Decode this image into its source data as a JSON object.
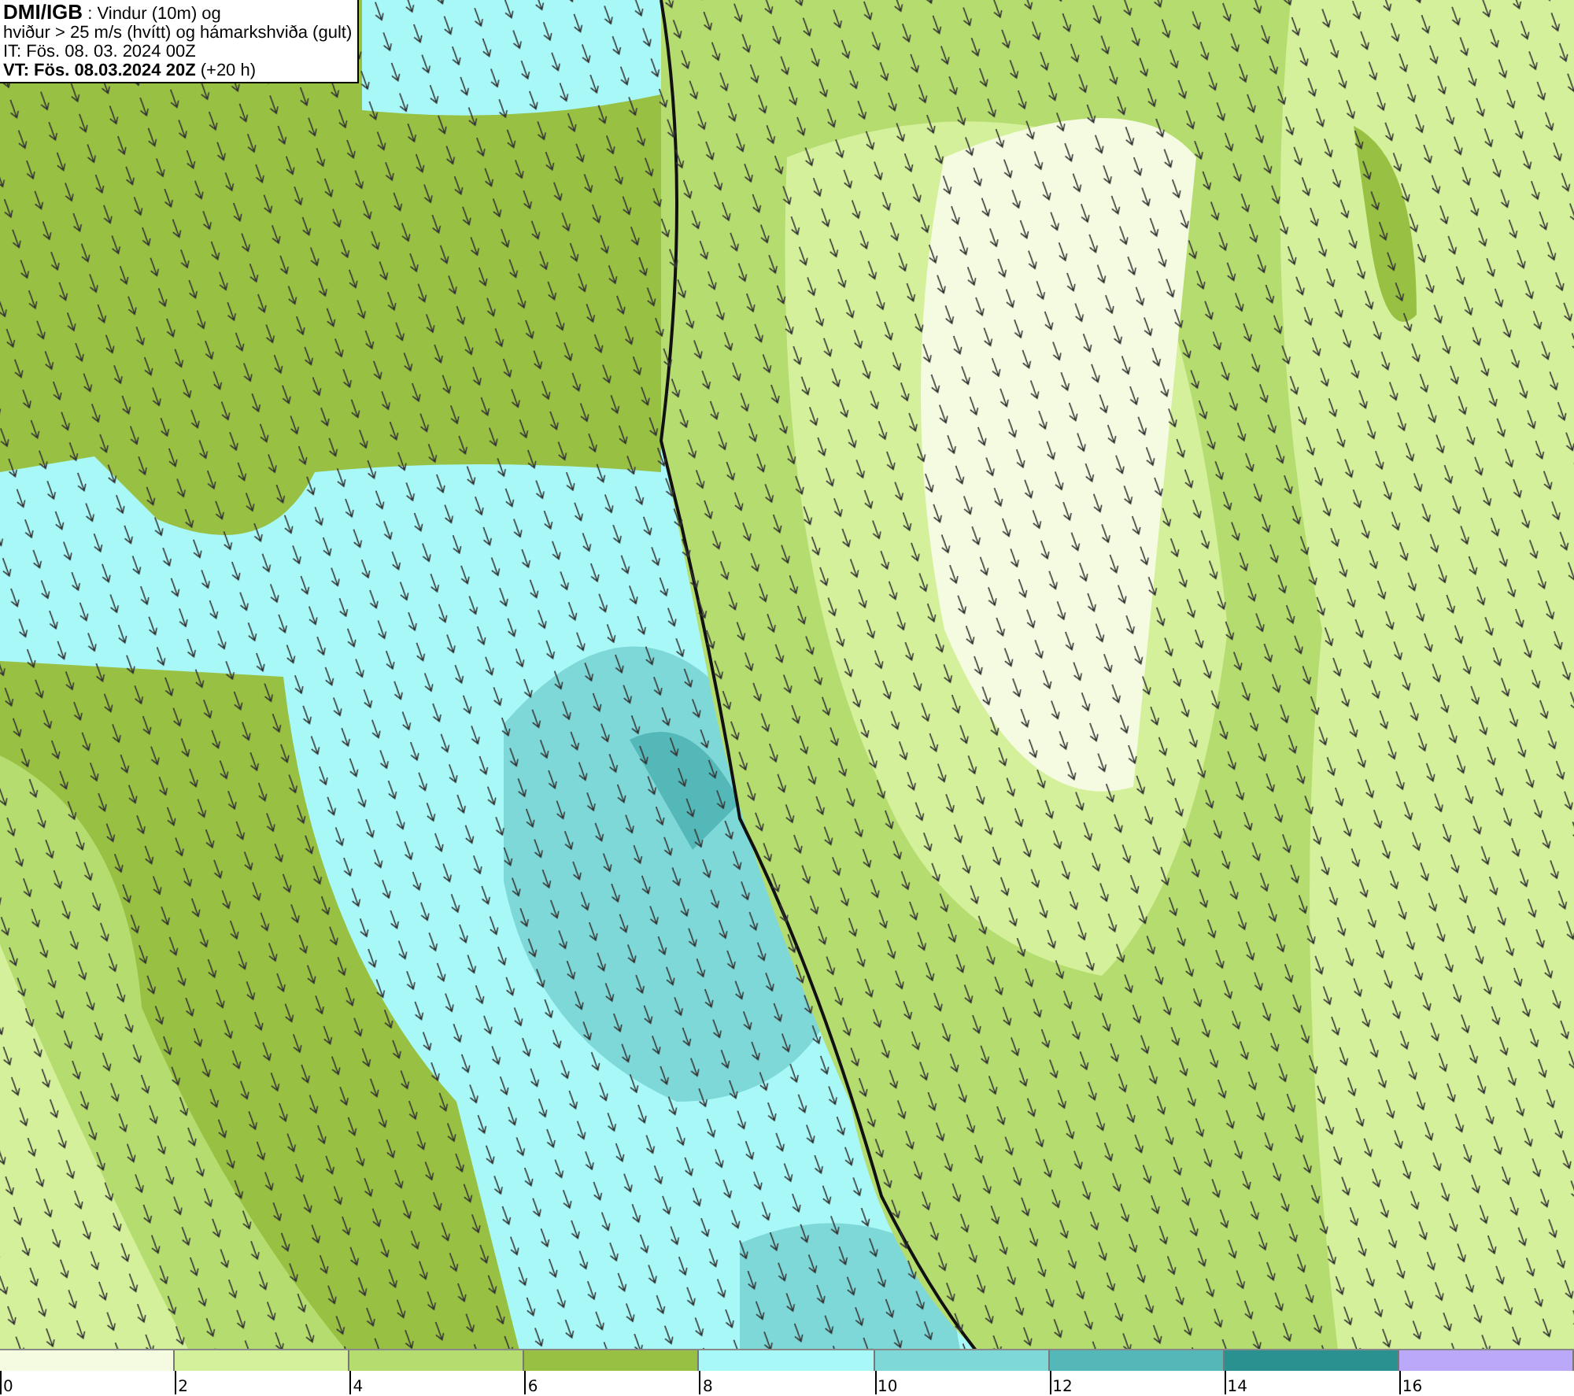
{
  "info_box": {
    "lines": [
      "**DMI/IGB** : Vindur (10m) og",
      "hviður > 25 m/s (hvítt) og hámarkshviða (gult)",
      "IT: Fös. 08. 03. 2024 00Z",
      "**VT: Fös. 08.03.2024 20Z** (+20 h)"
    ]
  },
  "legend": [
    {
      "label": "0",
      "color": "#f5fbe0"
    },
    {
      "label": "2",
      "color": "#d4f09a"
    },
    {
      "label": "4",
      "color": "#b5dc6e"
    },
    {
      "label": "6",
      "color": "#98c042"
    },
    {
      "label": "8",
      "color": "#a8f8f8"
    },
    {
      "label": "10",
      "color": "#7fd8d8"
    },
    {
      "label": "12",
      "color": "#55b8b8"
    },
    {
      "label": "14",
      "color": "#2a9090"
    },
    {
      "label": "16",
      "color": "#bba8f8"
    }
  ]
}
